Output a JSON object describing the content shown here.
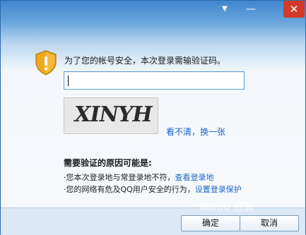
{
  "titlebar": {
    "menu_icon": "▼",
    "minimize_icon": "—",
    "close_icon": "✕"
  },
  "dialog": {
    "message": "为了您的帐号安全，本次登录需输验证码。",
    "captcha_text": "XINYH",
    "refresh_link": "看不清，换一张",
    "reason_title": "需要验证的原因可能是:",
    "reasons": [
      {
        "text": "·您本次登录地与常登录地不符，",
        "link": "查看登录地"
      },
      {
        "text": "·您的网络有危及QQ用户安全的行为，",
        "link": "设置登录保护"
      }
    ]
  },
  "buttons": {
    "ok": "确定",
    "cancel": "取消"
  },
  "watermark": "Baidu 经验",
  "colors": {
    "title_gradient_top": "#3f86cf",
    "close_button": "#d43a2a",
    "link": "#1b67c9",
    "shield": "#f0a81c"
  }
}
